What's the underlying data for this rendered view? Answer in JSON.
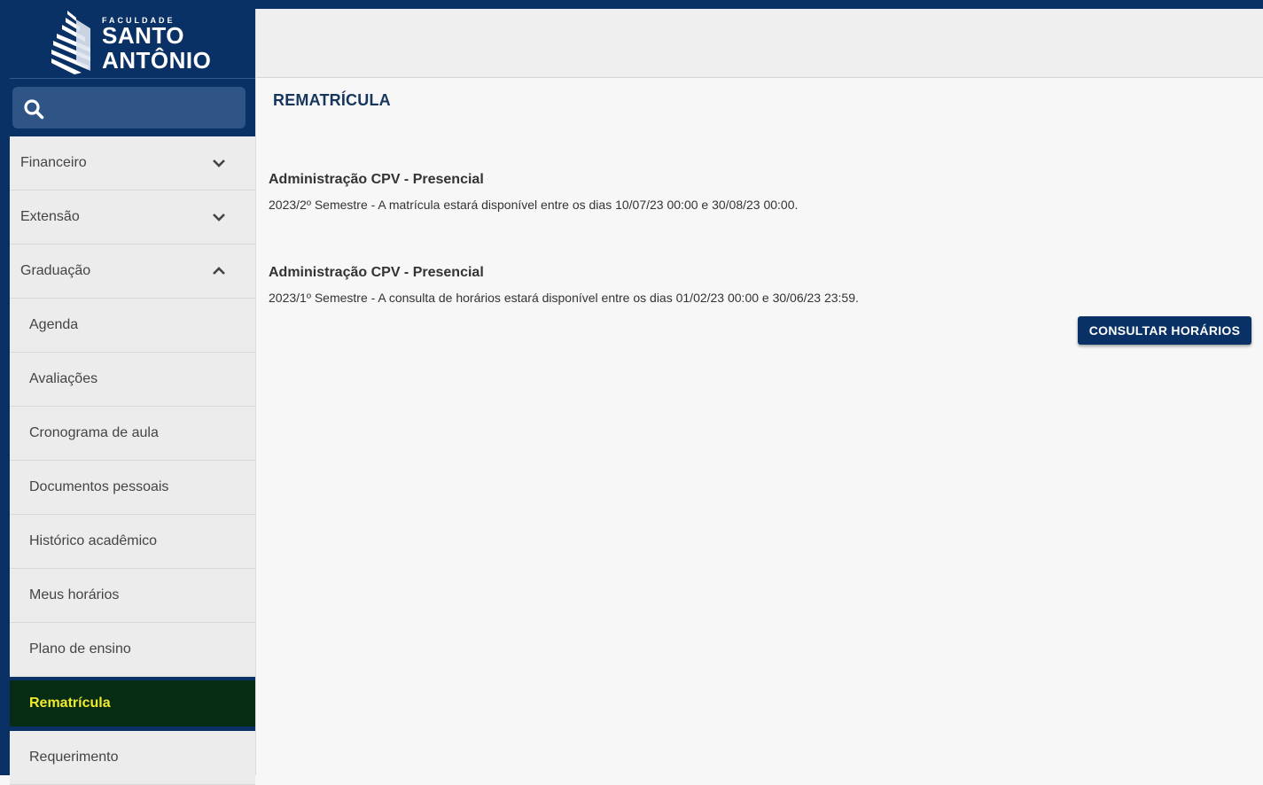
{
  "logo": {
    "line_small": "FACULDADE",
    "line1": "SANTO",
    "line2": "ANTÔNIO"
  },
  "search": {
    "placeholder": ""
  },
  "sidebar": {
    "items": [
      {
        "label": "Financeiro",
        "icon": "chevron-down-icon"
      },
      {
        "label": "Extensão",
        "icon": "chevron-down-icon"
      },
      {
        "label": "Graduação",
        "icon": "chevron-up-icon"
      },
      {
        "label": "Agenda"
      },
      {
        "label": "Avaliações"
      },
      {
        "label": "Cronograma de aula"
      },
      {
        "label": "Documentos pessoais"
      },
      {
        "label": "Histórico acadêmico"
      },
      {
        "label": "Meus horários"
      },
      {
        "label": "Plano de ensino"
      },
      {
        "label": "Rematrícula",
        "active": true
      },
      {
        "label": "Requerimento"
      }
    ]
  },
  "main": {
    "title": "REMATRÍCULA",
    "entries": [
      {
        "title": "Administração CPV - Presencial",
        "description": "2023/2º Semestre - A matrícula estará disponível entre os dias 10/07/23 00:00 e 30/08/23 00:00."
      },
      {
        "title": "Administração CPV - Presencial",
        "description": "2023/1º Semestre - A consulta de horários estará disponível entre os dias 01/02/23 00:00 e 30/06/23 23:59.",
        "button_label": "CONSULTAR HORÁRIOS"
      }
    ]
  },
  "colors": {
    "brand_navy": "#0a3166",
    "active_bg": "#062c13",
    "active_text": "#f1ea2a",
    "title_blue": "#17365d"
  }
}
